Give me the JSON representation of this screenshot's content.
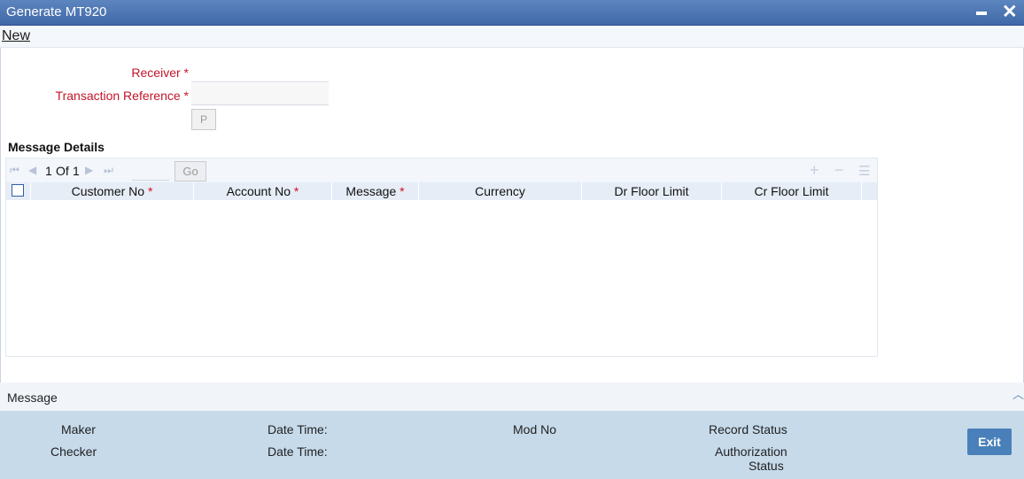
{
  "window": {
    "title": "Generate MT920",
    "minimize_icon": "minimize-icon",
    "close_icon": "close-icon",
    "close_glyph": "✕"
  },
  "toolbar": {
    "new_label": "New"
  },
  "form": {
    "receiver_label": "Receiver",
    "receiver_value": "",
    "transaction_reference_label": "Transaction Reference",
    "transaction_reference_value": "",
    "required_marker": "*",
    "p_button_label": "P"
  },
  "message_details": {
    "title": "Message Details",
    "pager": {
      "first_icon": "first-page-icon",
      "prev_icon": "previous-page-icon",
      "next_icon": "next-page-icon",
      "last_icon": "last-page-icon",
      "current_page": "1",
      "of_label": "Of",
      "total_pages": "1",
      "page_input_value": "",
      "go_label": "Go"
    },
    "tools": {
      "add_icon": "add-row-icon",
      "delete_icon": "delete-row-icon",
      "columns_icon": "columns-icon"
    },
    "columns": [
      {
        "label": "Customer No",
        "required": true
      },
      {
        "label": "Account No",
        "required": true
      },
      {
        "label": "Message",
        "required": true
      },
      {
        "label": "Currency",
        "required": false
      },
      {
        "label": "Dr Floor Limit",
        "required": false
      },
      {
        "label": "Cr Floor Limit",
        "required": false
      }
    ],
    "rows": []
  },
  "message_bar": {
    "label": "Message",
    "collapse_icon": "chevron-up-icon"
  },
  "audit": {
    "maker_label": "Maker",
    "checker_label": "Checker",
    "date_time_label_1": "Date Time:",
    "date_time_label_2": "Date Time:",
    "mod_no_label": "Mod No",
    "record_status_label": "Record Status",
    "authorization_label": "Authorization",
    "status_label": "Status"
  },
  "exit_label": "Exit",
  "colors": {
    "title_bar": "#4a73b3",
    "required": "#c0152a",
    "footer": "#c6daea",
    "exit_button": "#4a80b9"
  }
}
